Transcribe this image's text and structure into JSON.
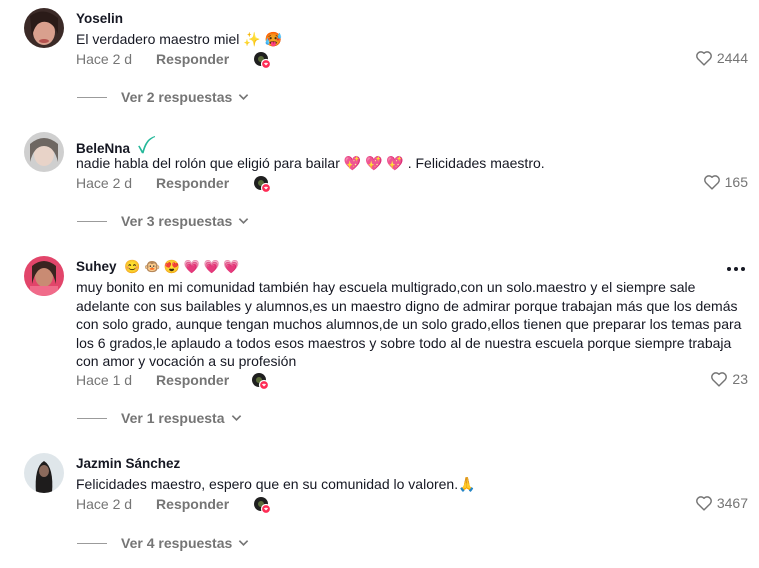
{
  "comments": [
    {
      "username": "Yoselin",
      "text": "El verdadero maestro miel ✨ 🥵",
      "time": "Hace 2 d",
      "reply_label": "Responder",
      "likes": "2444",
      "replies_label": "Ver 2 respuestas"
    },
    {
      "username": "BeleNna",
      "username_badge": "ꪜ",
      "text": "nadie habla del rolón que eligió para bailar 💖 💖 💖 . Felicidades maestro.",
      "time": "Hace 2 d",
      "reply_label": "Responder",
      "likes": "165",
      "replies_label": "Ver 3 respuestas"
    },
    {
      "username": "Suhey",
      "username_emojis": "😊 🐵 😍 💗 💗 💗",
      "text": "muy bonito en mi comunidad también hay escuela multigrado,con un solo.maestro y el siempre sale adelante con sus bailables y alumnos,es un maestro digno de admirar porque trabajan más que los demás con solo grado, aunque tengan muchos alumnos,de un solo grado,ellos tienen que preparar los temas para los 6 grados,le aplaudo a todos esos maestros y sobre todo al de nuestra escuela porque siempre trabaja con amor y vocación a su profesión",
      "time": "Hace 1 d",
      "reply_label": "Responder",
      "likes": "23",
      "replies_label": "Ver 1 respuesta"
    },
    {
      "username": "Jazmin Sánchez",
      "text": "Felicidades maestro, espero que en su comunidad lo valoren.🙏",
      "time": "Hace 2 d",
      "reply_label": "Responder",
      "likes": "3467",
      "replies_label": "Ver 4 respuestas"
    }
  ],
  "icons": {
    "heart": "heart-outline-icon",
    "chevron": "chevron-down-icon",
    "more": "more-options-icon",
    "creator_like": "creator-liked-avatar-icon"
  },
  "colors": {
    "meta_text": "#757575",
    "badge": "#25b89a",
    "creator_heart": "#fe2c55"
  }
}
